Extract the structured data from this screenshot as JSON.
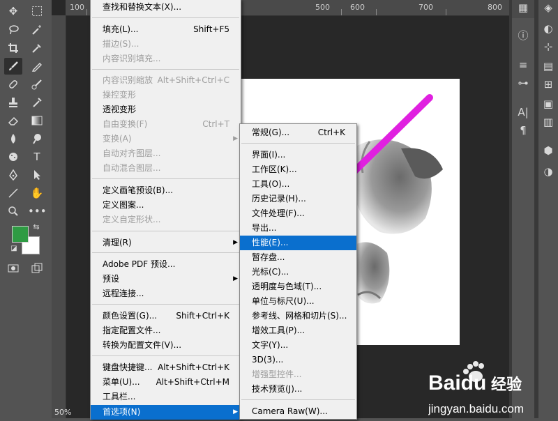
{
  "ruler": {
    "labels": [
      "100",
      "700",
      "800"
    ],
    "labels2": [
      "500",
      "600"
    ]
  },
  "status": {
    "zoom": "50%"
  },
  "colors": {
    "foreground": "#2e9b43",
    "background": "#ffffff",
    "highlight": "#0a6fce",
    "arrow": "#e020e0"
  },
  "edit_menu": {
    "items": [
      {
        "label": "查找和替换文本(X)...",
        "shortcut": "",
        "disabled": false
      },
      {
        "label": "填充(L)...",
        "shortcut": "Shift+F5",
        "disabled": false
      },
      {
        "label": "描边(S)...",
        "shortcut": "",
        "disabled": true
      },
      {
        "label": "内容识别填充...",
        "shortcut": "",
        "disabled": true
      },
      {
        "label": "内容识别缩放",
        "shortcut": "Alt+Shift+Ctrl+C",
        "disabled": true
      },
      {
        "label": "操控变形",
        "shortcut": "",
        "disabled": true
      },
      {
        "label": "透视变形",
        "shortcut": "",
        "disabled": false
      },
      {
        "label": "自由变换(F)",
        "shortcut": "Ctrl+T",
        "disabled": true
      },
      {
        "label": "变换(A)",
        "shortcut": "",
        "disabled": true
      },
      {
        "label": "自动对齐图层...",
        "shortcut": "",
        "disabled": true
      },
      {
        "label": "自动混合图层...",
        "shortcut": "",
        "disabled": true
      },
      {
        "label": "定义画笔预设(B)...",
        "shortcut": "",
        "disabled": false
      },
      {
        "label": "定义图案...",
        "shortcut": "",
        "disabled": false
      },
      {
        "label": "定义自定形状...",
        "shortcut": "",
        "disabled": true
      },
      {
        "label": "清理(R)",
        "shortcut": "",
        "disabled": false
      },
      {
        "label": "Adobe PDF 预设...",
        "shortcut": "",
        "disabled": false
      },
      {
        "label": "预设",
        "shortcut": "",
        "disabled": false
      },
      {
        "label": "远程连接...",
        "shortcut": "",
        "disabled": false
      },
      {
        "label": "颜色设置(G)...",
        "shortcut": "Shift+Ctrl+K",
        "disabled": false
      },
      {
        "label": "指定配置文件...",
        "shortcut": "",
        "disabled": false
      },
      {
        "label": "转换为配置文件(V)...",
        "shortcut": "",
        "disabled": false
      },
      {
        "label": "键盘快捷键...",
        "shortcut": "Alt+Shift+Ctrl+K",
        "disabled": false
      },
      {
        "label": "菜单(U)...",
        "shortcut": "Alt+Shift+Ctrl+M",
        "disabled": false
      },
      {
        "label": "工具栏...",
        "shortcut": "",
        "disabled": false
      },
      {
        "label": "首选项(N)",
        "shortcut": "",
        "disabled": false
      }
    ]
  },
  "prefs_menu": {
    "items": [
      {
        "label": "常规(G)...",
        "shortcut": "Ctrl+K",
        "disabled": false
      },
      {
        "label": "界面(I)...",
        "shortcut": "",
        "disabled": false
      },
      {
        "label": "工作区(K)...",
        "shortcut": "",
        "disabled": false
      },
      {
        "label": "工具(O)...",
        "shortcut": "",
        "disabled": false
      },
      {
        "label": "历史记录(H)...",
        "shortcut": "",
        "disabled": false
      },
      {
        "label": "文件处理(F)...",
        "shortcut": "",
        "disabled": false
      },
      {
        "label": "导出...",
        "shortcut": "",
        "disabled": false
      },
      {
        "label": "性能(E)...",
        "shortcut": "",
        "disabled": false
      },
      {
        "label": "暂存盘...",
        "shortcut": "",
        "disabled": false
      },
      {
        "label": "光标(C)...",
        "shortcut": "",
        "disabled": false
      },
      {
        "label": "透明度与色域(T)...",
        "shortcut": "",
        "disabled": false
      },
      {
        "label": "单位与标尺(U)...",
        "shortcut": "",
        "disabled": false
      },
      {
        "label": "参考线、网格和切片(S)...",
        "shortcut": "",
        "disabled": false
      },
      {
        "label": "增效工具(P)...",
        "shortcut": "",
        "disabled": false
      },
      {
        "label": "文字(Y)...",
        "shortcut": "",
        "disabled": false
      },
      {
        "label": "3D(3)...",
        "shortcut": "",
        "disabled": false
      },
      {
        "label": "增强型控件...",
        "shortcut": "",
        "disabled": true
      },
      {
        "label": "技术预览(J)...",
        "shortcut": "",
        "disabled": false
      },
      {
        "label": "Camera Raw(W)...",
        "shortcut": "",
        "disabled": false
      }
    ]
  },
  "watermark": {
    "brand": "Baidu",
    "cn": "经验",
    "url": "jingyan.baidu.com"
  }
}
